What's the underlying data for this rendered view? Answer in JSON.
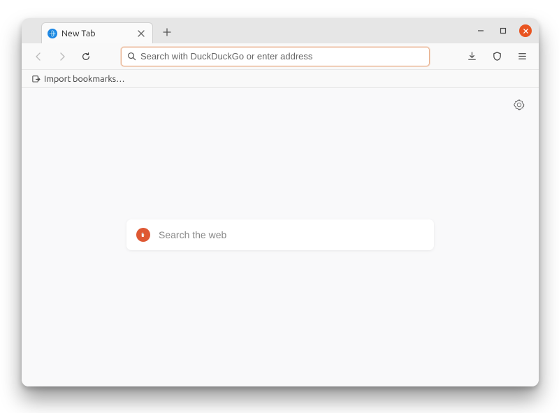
{
  "tabs": [
    {
      "title": "New Tab"
    }
  ],
  "addressbar": {
    "placeholder": "Search with DuckDuckGo or enter address",
    "value": ""
  },
  "bookmarks": {
    "import_label": "Import bookmarks…"
  },
  "newtab": {
    "search_placeholder": "Search the web"
  }
}
